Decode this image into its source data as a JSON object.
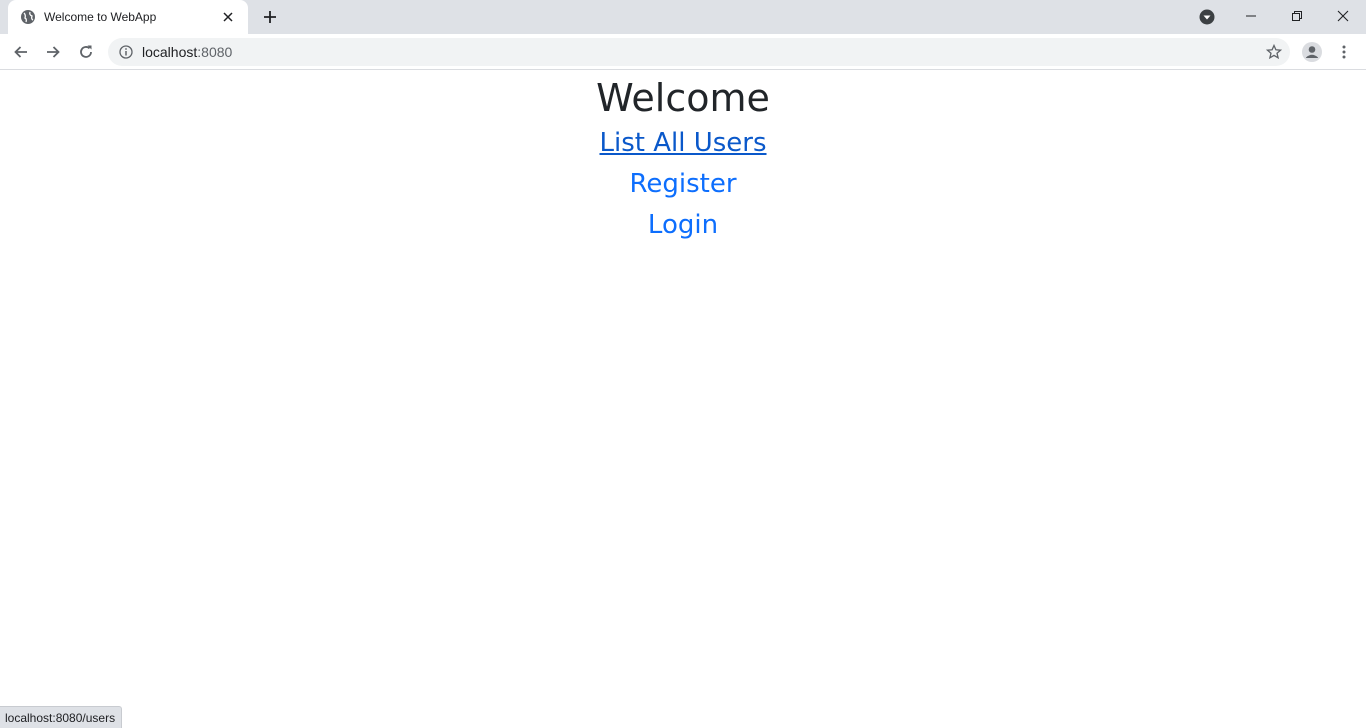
{
  "browser": {
    "tab_title": "Welcome to WebApp",
    "url_host": "localhost",
    "url_port": ":8080",
    "status_url": "localhost:8080/users",
    "icons": {
      "favicon": "globe-icon",
      "tab_close": "close-icon",
      "new_tab": "plus-icon",
      "tab_search": "chevron-down-circle-icon",
      "minimize": "minimize-icon",
      "restore": "restore-icon",
      "close_window": "close-icon",
      "back": "back-arrow-icon",
      "forward": "forward-arrow-icon",
      "reload": "reload-icon",
      "site_info": "info-icon",
      "bookmark": "star-icon",
      "profile": "profile-icon",
      "menu": "kebab-menu-icon"
    }
  },
  "page": {
    "heading": "Welcome",
    "links": [
      {
        "label": "List All Users",
        "state": "hover"
      },
      {
        "label": "Register"
      },
      {
        "label": "Login"
      }
    ],
    "colors": {
      "heading": "#212529",
      "link": "#0d6efd",
      "link_hover": "#0a58ca"
    }
  }
}
